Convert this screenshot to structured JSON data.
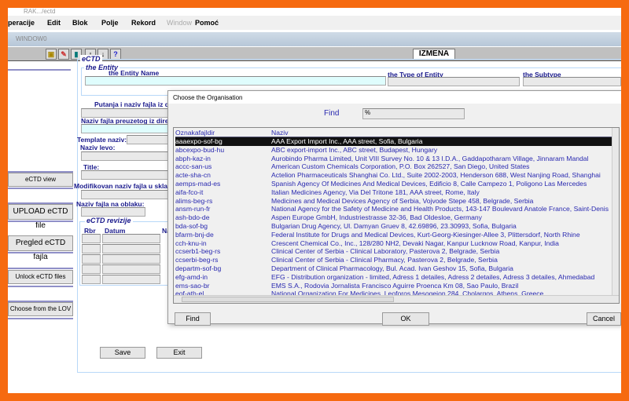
{
  "window": {
    "title": "RAK.../ectd",
    "mdi_title": "WINDOW0",
    "mode": "IZMENA"
  },
  "menu": [
    "peracije",
    "Edit",
    "Blok",
    "Polje",
    "Rekord",
    "Window",
    "Pomoć"
  ],
  "toolbar_icons": [
    "save-icon",
    "clear-icon",
    "exit-icon",
    "up-arrow-icon",
    "down-arrow-icon",
    "help-icon"
  ],
  "form": {
    "ectd_frame": "eCTD",
    "entity_frame": "the Entity",
    "entity_name": "the Entity Name",
    "entity_type": "the Type of Entity",
    "entity_subtype": "the Subtype",
    "putanja": "Putanja i naziv fajla iz d",
    "naziv_fajla_dir": "Naziv fajla preuzetog iz dire",
    "template": "Template naziv:",
    "naziv_levo": "Naziv levo:",
    "title": "Title:",
    "modifikovan": "Modifikovan naziv fajla u sklad",
    "oblak": "Naziv fajla na oblaku:",
    "revizije_frame": "eCTD revizije",
    "rev_cols": [
      "Rbr",
      "Datum",
      "Na"
    ],
    "save": "Save",
    "exit": "Exit"
  },
  "side_buttons": [
    "eCTD view",
    "UPLOAD eCTD file",
    "Pregled eCTD fajla",
    "Unlock eCTD files",
    "Choose from the LOV"
  ],
  "dialog": {
    "title": "Choose the Organisation",
    "find_label": "Find",
    "find_value": "%",
    "columns": [
      "Oznakafajldir",
      "Naziv"
    ],
    "rows": [
      [
        "aaaexpo-sof-bg",
        "AAA Export Import Inc., AAA street, Sofia, Bulgaria"
      ],
      [
        "abcexpo-bud-hu",
        "ABC export-import Inc., ABC  street, Budapest, Hungary"
      ],
      [
        "abph-kaz-in",
        "Aurobindo Pharma Limited, Unit VIII Survey No. 10 & 13 I.D.A., Gaddapotharam Village, Jinnaram Mandal"
      ],
      [
        "accc-san-us",
        "American Custom Chemicals Corporation, P.O. Box 262527, San Diego, United States"
      ],
      [
        "acte-sha-cn",
        "Actelion Pharmaceuticals Shanghai Co. Ltd., Suite 2002-2003, Henderson 688, West Nanjing Road, Shanghai"
      ],
      [
        "aemps-mad-es",
        "Spanish Agency Of Medicines And Medical Devices, Edificio 8, Calle Campezo 1, Poligono Las Mercedes"
      ],
      [
        "aifa-fco-it",
        "Italian Medicines Agency, Via Del Tritone 181, AAA street, Rome, Italy"
      ],
      [
        "alims-beg-rs",
        "Medicines and Medical Devices Agency of Serbia, Vojvode Stepe 458, Belgrade, Serbia"
      ],
      [
        "ansm-run-fr",
        "National Agency for the Safety of Medicine and Health Products, 143-147 Boulevard Anatole France, Saint-Denis"
      ],
      [
        "ash-bdo-de",
        "Aspen Europe GmbH, Industriestrasse 32-36, Bad Oldesloe, Germany"
      ],
      [
        "bda-sof-bg",
        "Bulgarian Drug Agency, Ul. Damyan Gruev 8, 42.69896, 23.30993, Sofia, Bulgaria"
      ],
      [
        "bfarm-bnj-de",
        "Federal Institute for Drugs and Medical Devices, Kurt-Georg-Kiesinger-Allee 3, Plittersdorf, North Rhine"
      ],
      [
        "cch-knu-in",
        "Crescent Chemical Co., Inc., 128/280 NH2, Devaki Nagar, Kanpur Lucknow Road, Kanpur, India"
      ],
      [
        "ccserb1-beg-rs",
        "Clinical Center of Serbia - Clinical Laboratory, Pasterova 2, Belgrade, Serbia"
      ],
      [
        "ccserbi-beg-rs",
        "Clinical Center of Serbia - Clinical Pharmacy, Pasterova 2, Belgrade, Serbia"
      ],
      [
        "departm-sof-bg",
        "Department of Clinical Pharmacology, Bul. Acad. Ivan Geshov 15, Sofia, Bulgaria"
      ],
      [
        "efg-amd-in",
        "EFG - Distribution organization - limited, Adress 1 detailes, Adress 2 detailes, Adress 3 detailes, Ahmedabad"
      ],
      [
        "ems-sao-br",
        "EMS S.A., Rodovia Jornalista Francisco Aguirre Proenca Km 08, Sao Paulo, Brazil"
      ],
      [
        "eof-ath-el",
        "National Organization For Medicines, Leoforos Mesogeion 284, Cholargos, Athens, Greece"
      ]
    ],
    "buttons": {
      "find": "Find",
      "ok": "OK",
      "cancel": "Cancel"
    }
  }
}
